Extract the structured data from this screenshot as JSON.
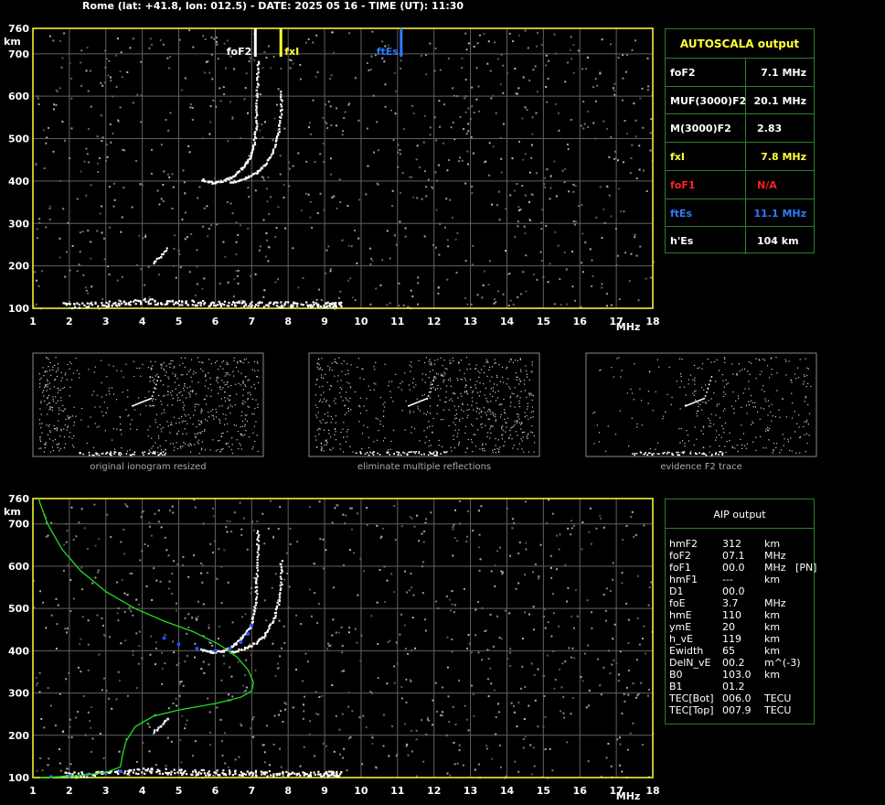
{
  "header": {
    "title": "Rome (lat: +41.8, lon: 012.5) - DATE: 2025 05 16 - TIME (UT): 11:30"
  },
  "colors": {
    "frame": "#ffff3b",
    "grid": "#606060",
    "trace": "#ffffff",
    "profile": "#22dd22",
    "fit": "#2a4bff",
    "fxI": "#ffff3b",
    "ftEs": "#2f7bff",
    "foF1": "#ff2020",
    "table_border": "#2e7d2e"
  },
  "chart_data": [
    {
      "type": "scatter",
      "name": "main-ionogram",
      "xlabel": "MHz",
      "ylabel": "km",
      "xlim": [
        1,
        18
      ],
      "ylim": [
        100,
        760
      ],
      "x_ticks": [
        1,
        2,
        3,
        4,
        5,
        6,
        7,
        8,
        9,
        10,
        11,
        12,
        13,
        14,
        15,
        16,
        17,
        18
      ],
      "y_ticks": [
        100,
        200,
        300,
        400,
        500,
        600,
        700,
        760
      ],
      "grid": true,
      "markers": [
        {
          "label": "foF2",
          "freq": 7.1,
          "color": "#ffffff"
        },
        {
          "label": "fxI",
          "freq": 7.8,
          "color": "#ffff3b"
        },
        {
          "label": "ftEs",
          "freq": 11.1,
          "color": "#2f7bff"
        }
      ],
      "traces": {
        "F2_ordinary": [
          [
            5.6,
            405
          ],
          [
            5.9,
            398
          ],
          [
            6.2,
            402
          ],
          [
            6.5,
            415
          ],
          [
            6.75,
            435
          ],
          [
            6.95,
            460
          ],
          [
            7.05,
            490
          ],
          [
            7.1,
            530
          ],
          [
            7.12,
            580
          ],
          [
            7.14,
            640
          ],
          [
            7.15,
            690
          ]
        ],
        "F2_extraordinary": [
          [
            6.4,
            398
          ],
          [
            6.8,
            408
          ],
          [
            7.1,
            420
          ],
          [
            7.35,
            440
          ],
          [
            7.55,
            470
          ],
          [
            7.7,
            510
          ],
          [
            7.78,
            560
          ],
          [
            7.8,
            620
          ]
        ],
        "F2_low_fragment": [
          [
            4.3,
            210
          ],
          [
            4.5,
            225
          ],
          [
            4.7,
            245
          ]
        ],
        "Es_trace": [
          [
            1.8,
            108
          ],
          [
            3,
            112
          ],
          [
            4,
            118
          ],
          [
            5,
            115
          ],
          [
            6,
            113
          ],
          [
            7,
            112
          ],
          [
            8,
            111
          ],
          [
            9,
            110
          ],
          [
            9.4,
            110
          ]
        ]
      }
    },
    {
      "type": "scatter",
      "name": "aip-ionogram",
      "xlabel": "MHz",
      "ylabel": "km",
      "xlim": [
        1,
        18
      ],
      "ylim": [
        100,
        760
      ],
      "x_ticks": [
        1,
        2,
        3,
        4,
        5,
        6,
        7,
        8,
        9,
        10,
        11,
        12,
        13,
        14,
        15,
        16,
        17,
        18
      ],
      "y_ticks": [
        100,
        200,
        300,
        400,
        500,
        600,
        700,
        760
      ],
      "grid": true,
      "profile": [
        [
          1.15,
          760
        ],
        [
          1.4,
          700
        ],
        [
          1.8,
          640
        ],
        [
          2.3,
          590
        ],
        [
          3,
          540
        ],
        [
          3.8,
          500
        ],
        [
          4.6,
          470
        ],
        [
          5.4,
          445
        ],
        [
          6.1,
          415
        ],
        [
          6.6,
          385
        ],
        [
          6.9,
          355
        ],
        [
          7.05,
          325
        ],
        [
          7.0,
          305
        ],
        [
          6.7,
          290
        ],
        [
          6.0,
          275
        ],
        [
          5.0,
          260
        ],
        [
          4.3,
          245
        ],
        [
          3.8,
          220
        ],
        [
          3.55,
          185
        ],
        [
          3.45,
          150
        ],
        [
          3.4,
          125
        ],
        [
          3.0,
          112
        ],
        [
          2.2,
          104
        ],
        [
          1.2,
          100
        ]
      ],
      "fit_points": [
        [
          4.6,
          430
        ],
        [
          5.0,
          415
        ],
        [
          5.5,
          405
        ],
        [
          6.0,
          400
        ],
        [
          6.4,
          405
        ],
        [
          6.7,
          420
        ],
        [
          6.9,
          440
        ],
        [
          7.0,
          460
        ],
        [
          1.5,
          102
        ],
        [
          2.0,
          104
        ],
        [
          2.5,
          107
        ],
        [
          3.0,
          110
        ],
        [
          3.4,
          115
        ]
      ]
    }
  ],
  "autoscala": {
    "title": "AUTOSCALA output",
    "rows": [
      {
        "key": "foF2",
        "value": "7.1 MHz",
        "color": "#ffffff"
      },
      {
        "key": "MUF(3000)F2",
        "value": "20.1 MHz",
        "color": "#ffffff"
      },
      {
        "key": "M(3000)F2",
        "value": "2.83",
        "color": "#ffffff"
      },
      {
        "key": "fxI",
        "value": "7.8 MHz",
        "color": "#ffff3b"
      },
      {
        "key": "foF1",
        "value": "N/A",
        "color": "#ff2020"
      },
      {
        "key": "ftEs",
        "value": "11.1 MHz",
        "color": "#2f7bff"
      },
      {
        "key": "h'Es",
        "value": "104    km",
        "color": "#ffffff"
      }
    ]
  },
  "aip": {
    "title": "AIP output",
    "rows": [
      {
        "k": "hmF2",
        "v": "312",
        "u": "km"
      },
      {
        "k": "foF2",
        "v": "07.1",
        "u": "MHz"
      },
      {
        "k": "foF1",
        "v": "00.0",
        "u": "MHz   [PN]"
      },
      {
        "k": "hmF1",
        "v": "---",
        "u": "km"
      },
      {
        "k": "D1",
        "v": "00.0",
        "u": ""
      },
      {
        "k": "foE",
        "v": "3.7",
        "u": "MHz"
      },
      {
        "k": "hmE",
        "v": "110",
        "u": "km"
      },
      {
        "k": "ymE",
        "v": "20",
        "u": "km"
      },
      {
        "k": "h_vE",
        "v": "119",
        "u": "km"
      },
      {
        "k": "Ewidth",
        "v": "65",
        "u": "km"
      },
      {
        "k": "DelN_vE",
        "v": "00.2",
        "u": "m^(-3)"
      },
      {
        "k": "B0",
        "v": "103.0",
        "u": "km"
      },
      {
        "k": "B1",
        "v": "01.2",
        "u": ""
      },
      {
        "k": "TEC[Bot]",
        "v": "006.0",
        "u": "TECU"
      },
      {
        "k": "TEC[Top]",
        "v": "007.9",
        "u": "TECU"
      }
    ]
  },
  "thumbnails": [
    {
      "caption": "original ionogram resized"
    },
    {
      "caption": "eliminate multiple reflections"
    },
    {
      "caption": "evidence F2 trace"
    }
  ]
}
